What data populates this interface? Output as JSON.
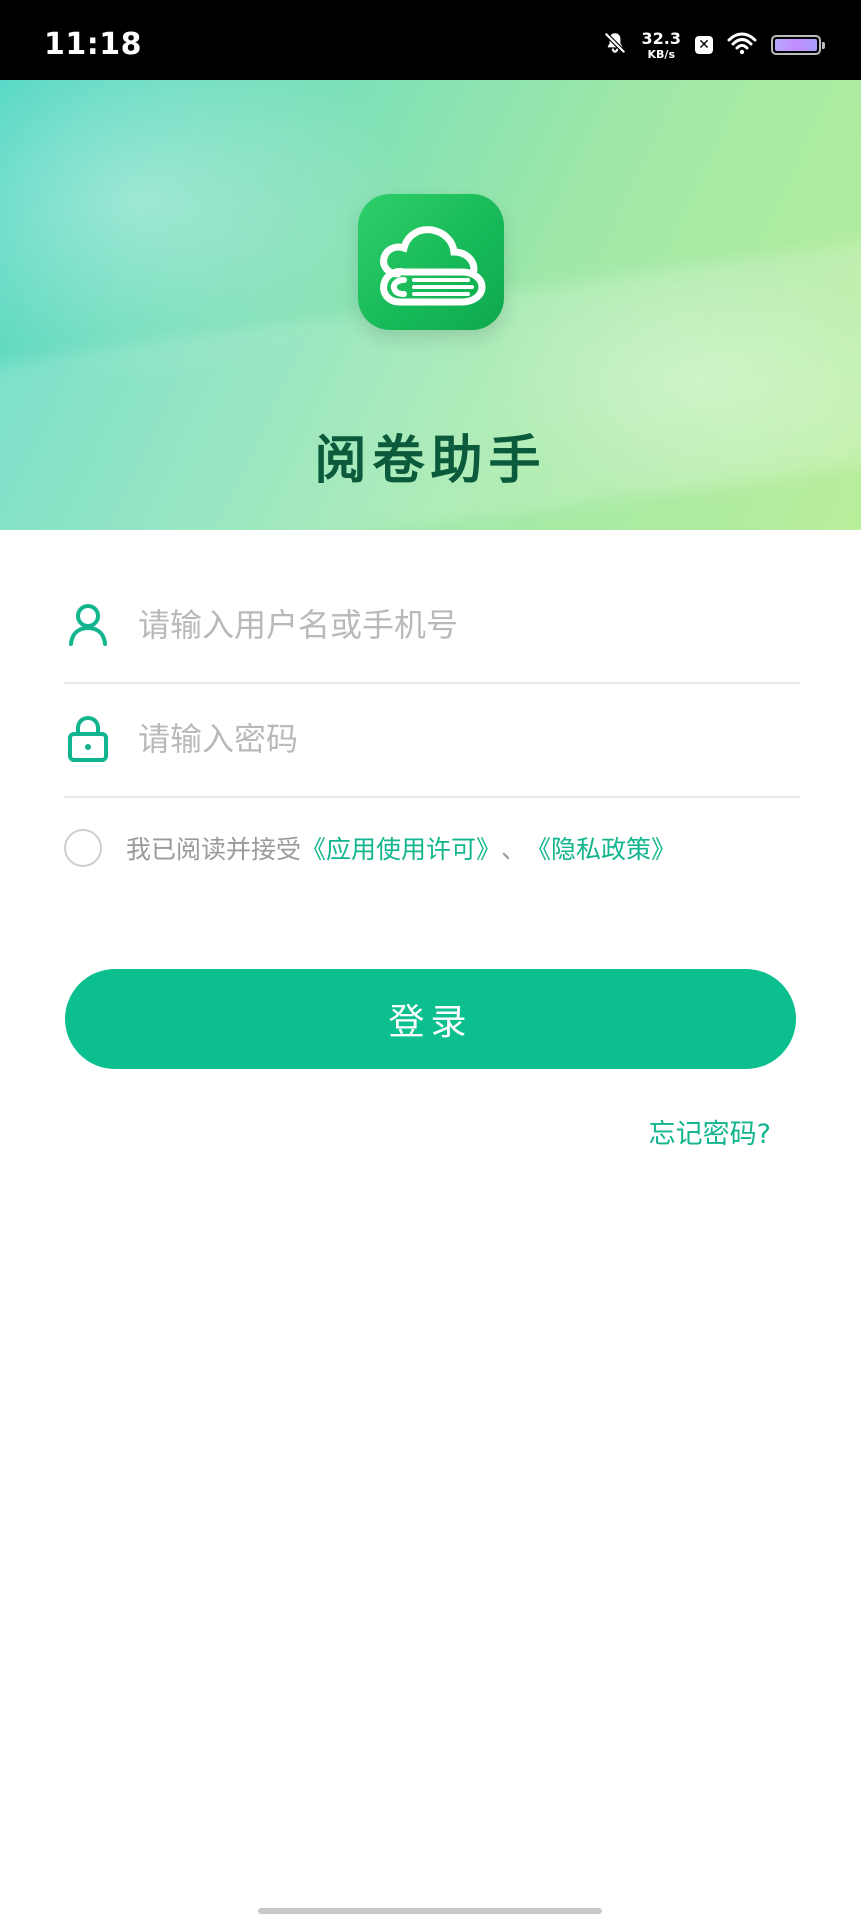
{
  "status_bar": {
    "time": "11:18",
    "net_speed_value": "32.3",
    "net_speed_unit": "KB/s",
    "box_icon_glyph": "✕",
    "icons": [
      "bell-muted-icon",
      "x-icon",
      "wifi-icon",
      "battery-icon"
    ]
  },
  "brand": {
    "app_name": "阅卷助手",
    "accent_color": "#12b58d"
  },
  "form": {
    "username_placeholder": "请输入用户名或手机号",
    "password_placeholder": "请输入密码",
    "agreement_prefix": "我已阅读并接受",
    "agreement_license": "《应用使用许可》",
    "agreement_separator": "、",
    "agreement_privacy": "《隐私政策》",
    "login_label": "登录",
    "forgot_label": "忘记密码?"
  }
}
